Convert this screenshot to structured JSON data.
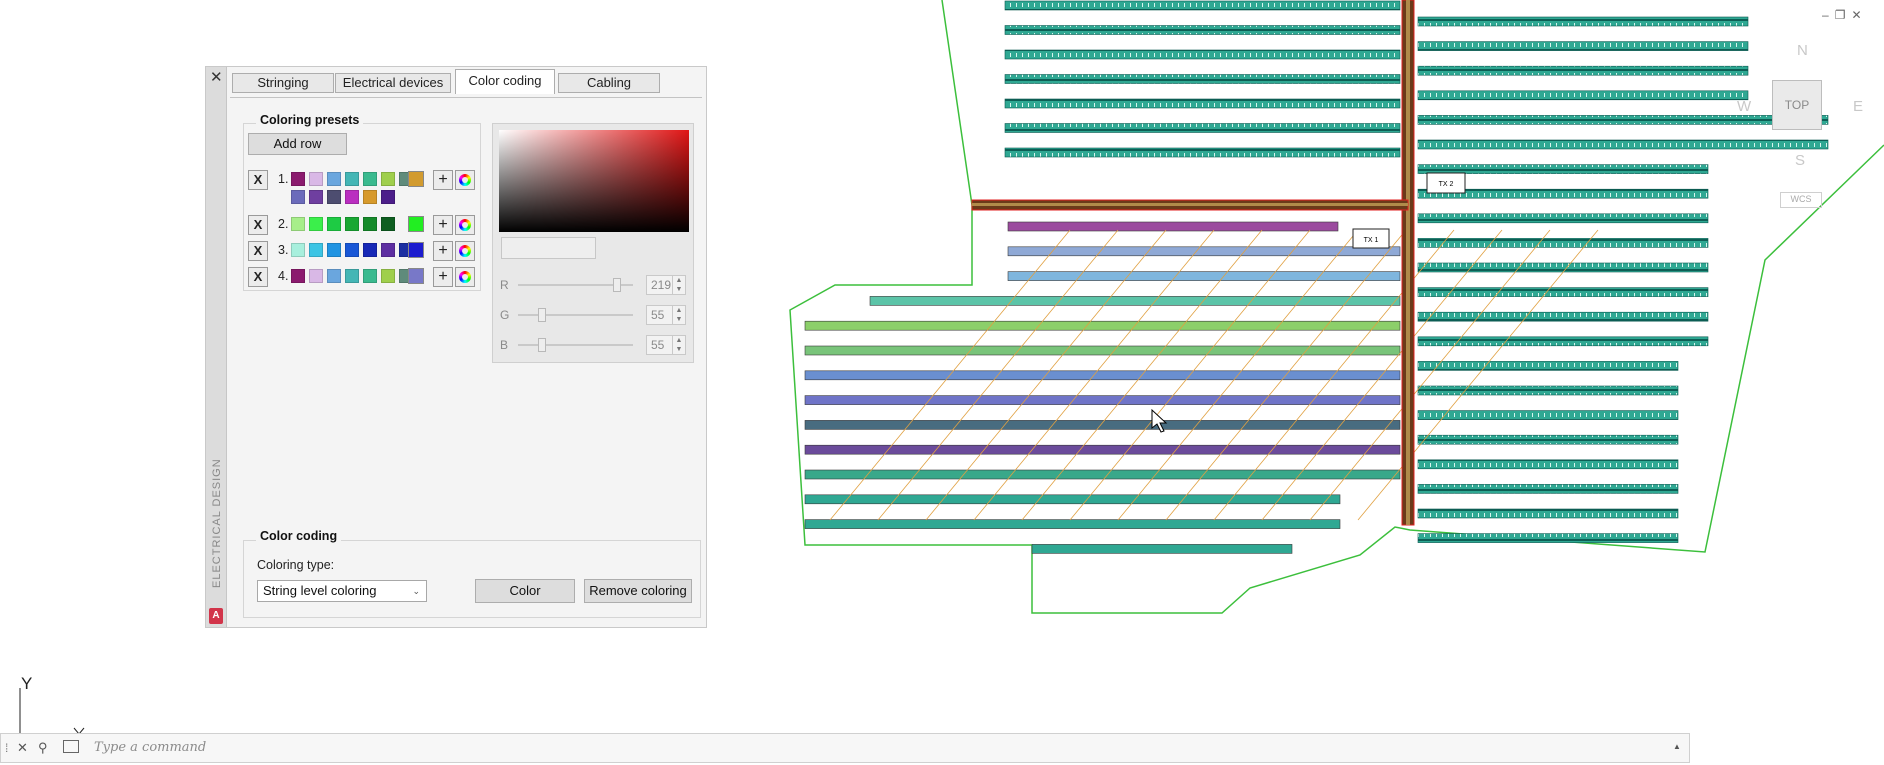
{
  "window_controls": {
    "minimize": "–",
    "restore": "❐",
    "close": "✕"
  },
  "palette": {
    "close_label": "✕",
    "side_title": "ELECTRICAL DESIGN",
    "app_badge": "A",
    "tabs": [
      {
        "label": "Stringing"
      },
      {
        "label": "Electrical devices"
      },
      {
        "label": "Color coding"
      },
      {
        "label": "Cabling"
      }
    ],
    "presets": {
      "title": "Coloring presets",
      "add_row_label": "Add row",
      "delete_label": "X",
      "add_label": "+",
      "rows": [
        {
          "number": "1.",
          "colors": [
            "#8b1a6e",
            "#d9b8e6",
            "#6aa6de",
            "#44b6b5",
            "#3aba8f",
            "#9fcf4c",
            "#5f8b7b",
            "#6b6bbb",
            "#6f3fa0",
            "#4d4d70",
            "#ba2ec0",
            "#d79a2b",
            "#4c1e8a"
          ],
          "main": "#d29b2f"
        },
        {
          "number": "2.",
          "colors": [
            "#a7ee8a",
            "#3bef4b",
            "#1ecb44",
            "#19a733",
            "#158a2a",
            "#0e5e20"
          ],
          "main": "#22ee22"
        },
        {
          "number": "3.",
          "colors": [
            "#a8efdd",
            "#3cc4e4",
            "#2194e2",
            "#1857d6",
            "#1729b7",
            "#5d2ea1",
            "#1b2fa2"
          ],
          "main": "#1c1ccf"
        },
        {
          "number": "4.",
          "colors": [
            "#8b1a6e",
            "#d9b8e6",
            "#6aa6de",
            "#44b6b5",
            "#3aba8f",
            "#9fcf4c",
            "#5f8b7b"
          ],
          "main": "#7878c8"
        }
      ]
    },
    "picker": {
      "r_label": "R",
      "r_value": "219",
      "g_label": "G",
      "g_value": "55",
      "b_label": "B",
      "b_value": "55",
      "up": "▲",
      "down": "▼"
    },
    "coding": {
      "title": "Color coding",
      "type_label": "Coloring type:",
      "type_value": "String level coloring",
      "color_button": "Color",
      "remove_button": "Remove coloring"
    }
  },
  "viewcube": {
    "top": "TOP",
    "north": "N",
    "south": "S",
    "east": "E",
    "west": "W",
    "wcs": "WCS"
  },
  "drawing": {
    "tx1": "TX 1",
    "tx2": "TX 2"
  },
  "ucs": {
    "y_label": "Y"
  },
  "command": {
    "placeholder": "Type a command"
  }
}
